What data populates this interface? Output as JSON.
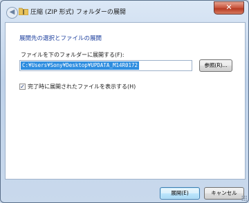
{
  "window": {
    "title": "圧縮 (ZIP 形式) フォルダーの展開",
    "close_glyph": "✕",
    "back_glyph": "◀"
  },
  "content": {
    "heading": "展開先の選択とファイルの展開",
    "destination_label": "ファイルを下のフォルダーに展開する(F):",
    "destination_value": "C:¥Users¥Sony¥Desktop¥UPDATA_M14R0172",
    "browse_label": "参照(R)...",
    "show_files_label": "完了時に展開されたファイルを表示する(H)",
    "show_files_checked": true,
    "check_glyph": "✓"
  },
  "footer": {
    "extract_label": "展開(E)",
    "cancel_label": "キャンセル"
  },
  "colors": {
    "heading": "#1c3f9e",
    "selection": "#2f8ee0",
    "close_button": "#c7523a"
  }
}
